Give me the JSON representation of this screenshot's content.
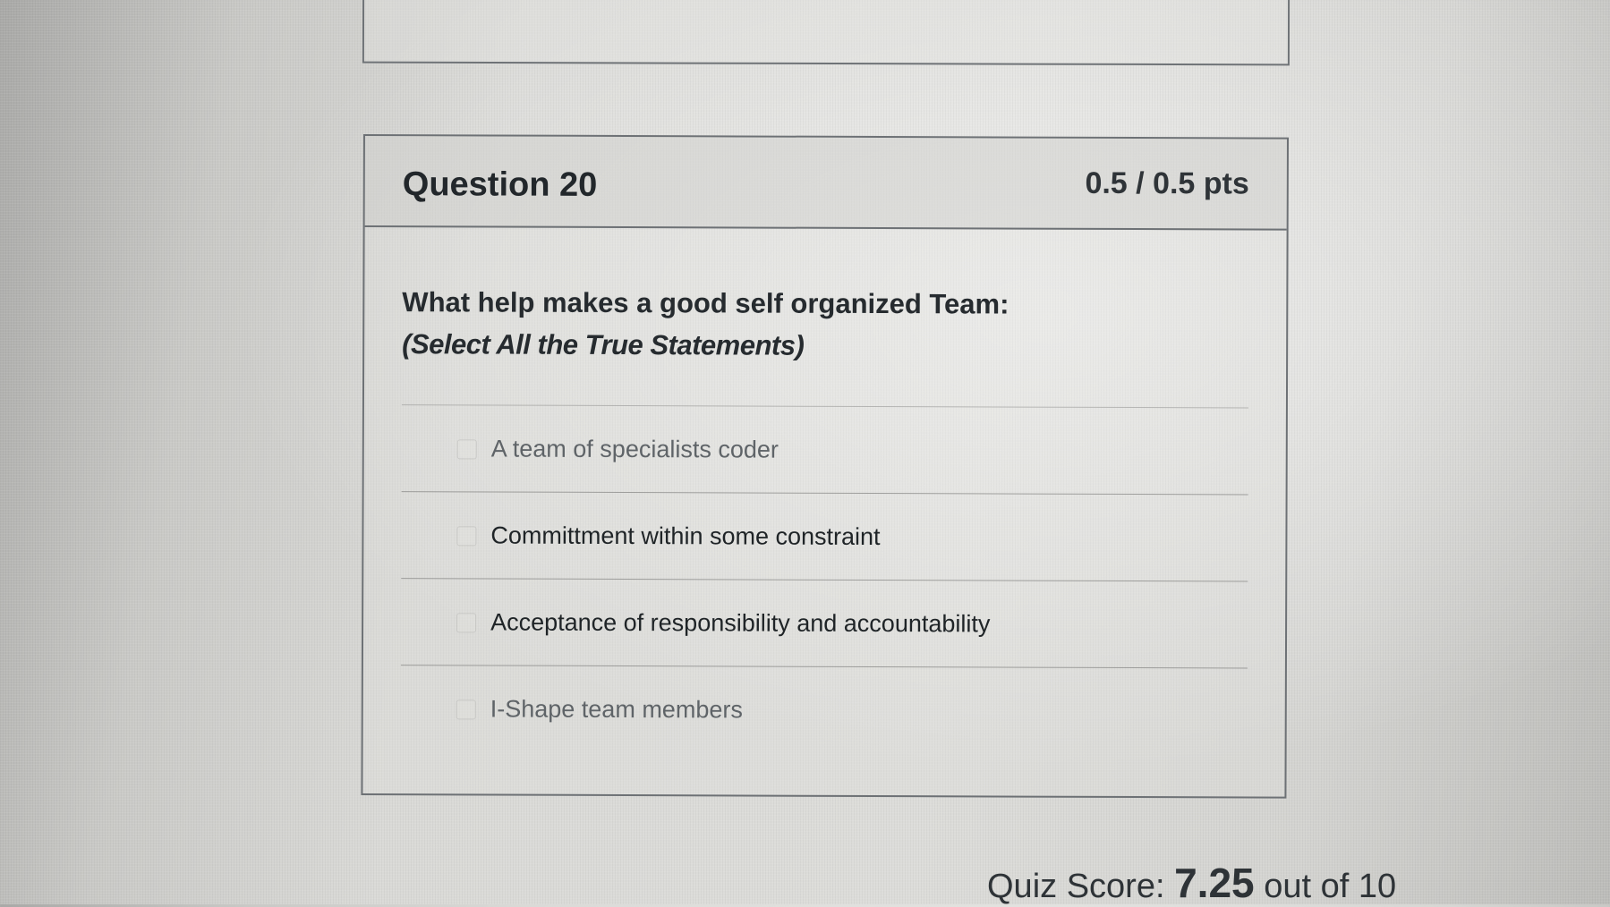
{
  "question": {
    "title": "Question 20",
    "points": "0.5 / 0.5 pts",
    "text": "What help makes a good self organized Team:",
    "hint": "(Select All the True Statements)",
    "answers": [
      {
        "label": "A team of specialists coder",
        "selected": false
      },
      {
        "label": "Committment within some constraint",
        "selected": true
      },
      {
        "label": "Acceptance of responsibility and accountability",
        "selected": true
      },
      {
        "label": "I-Shape team members",
        "selected": false
      }
    ]
  },
  "quiz_score": {
    "prefix": "Quiz Score:",
    "value": "7.25",
    "suffix": "out of 10"
  }
}
